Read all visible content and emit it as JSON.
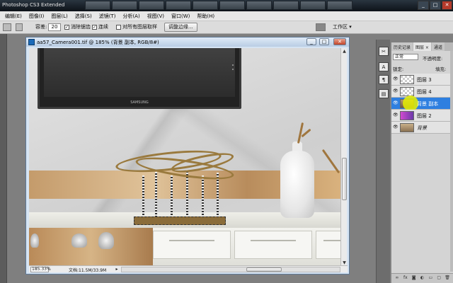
{
  "window": {
    "title": "Photoshop CS3 Extended",
    "minimize": "_",
    "maximize": "□",
    "close": "✕"
  },
  "menu": [
    "编辑(E)",
    "图像(I)",
    "图层(L)",
    "选择(S)",
    "滤镜(T)",
    "分析(A)",
    "视图(V)",
    "窗口(W)",
    "帮助(H)"
  ],
  "options": {
    "tolerance_label": "容差:",
    "tolerance_value": "20",
    "antialias_checked": "✓",
    "antialias_label": "消除锯齿",
    "contiguous_checked": "✓",
    "contiguous_label": "连续",
    "sample_all_label": "对所有图层取样",
    "refine_edge_button": "调整边缘...",
    "workspace_label": "工作区 ▾"
  },
  "document": {
    "title": "aa57_Camera001.tif @ 185% (背景 副本, RGB/8#)",
    "tv_brand": "SAMSUNG",
    "zoom": "185.33%",
    "doc_info": "文档:11.5M/33.9M",
    "status_arrow": "▸"
  },
  "dock_icons": [
    "✂",
    "A",
    "¶",
    "▤"
  ],
  "panel": {
    "tabs": [
      "历史记录",
      "图层 ×",
      "通道"
    ],
    "blend_mode": "正常",
    "opacity_label": "不透明度:",
    "lock_label": "锁定:",
    "fill_label": "填充:",
    "layers": [
      {
        "name": "图层 3",
        "visible_icon": "👁",
        "active": false
      },
      {
        "name": "图层 4",
        "visible_icon": "👁",
        "active": false
      },
      {
        "name": "背景 副本",
        "visible_icon": "👁",
        "active": true
      },
      {
        "name": "图层 2",
        "visible_icon": "👁",
        "active": false
      },
      {
        "name": "背景",
        "visible_icon": "👁",
        "active": false
      }
    ],
    "bottom_icons": [
      "∞",
      "fx",
      "◙",
      "◐",
      "▭",
      "▢",
      "🗑"
    ]
  },
  "colors": {
    "selected_layer": "#2e7fe0",
    "cursor_highlight": "#e6f000"
  }
}
